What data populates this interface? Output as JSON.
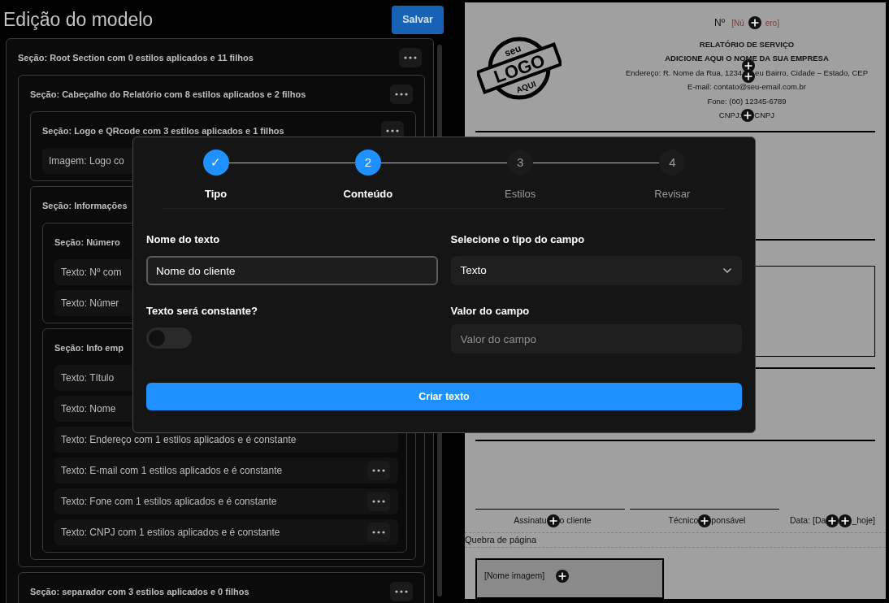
{
  "editor": {
    "title": "Edição do modelo",
    "save_button": "Salvar",
    "tree": [
      {
        "kind": "section",
        "label": "Seção: Root Section com 0 estilos aplicados e 11 filhos",
        "menu": true,
        "children": [
          {
            "kind": "section",
            "label": "Seção: Cabeçalho do Relatório com 8 estilos aplicados e 2 filhos",
            "menu": true,
            "children": [
              {
                "kind": "section",
                "label": "Seção: Logo e QRcode com 3 estilos aplicados e 1 filhos",
                "menu": true,
                "children": [
                  {
                    "kind": "item",
                    "label": "Imagem: Logo co"
                  }
                ]
              },
              {
                "kind": "section",
                "label": "Seção: Informações",
                "children": [
                  {
                    "kind": "section",
                    "label": "Seção: Número",
                    "children": [
                      {
                        "kind": "item",
                        "label": "Texto: Nº com"
                      },
                      {
                        "kind": "item",
                        "label": "Texto: Númer"
                      }
                    ]
                  },
                  {
                    "kind": "section",
                    "label": "Seção: Info emp",
                    "children": [
                      {
                        "kind": "item",
                        "label": "Texto: Título"
                      },
                      {
                        "kind": "item",
                        "label": "Texto: Nome"
                      },
                      {
                        "kind": "item",
                        "label": "Texto: Endereço com 1 estilos aplicados e é constante"
                      },
                      {
                        "kind": "item",
                        "label": "Texto: E-mail com 1 estilos aplicados e é constante",
                        "menu": true
                      },
                      {
                        "kind": "item",
                        "label": "Texto: Fone com 1 estilos aplicados e é constante",
                        "menu": true
                      },
                      {
                        "kind": "item",
                        "label": "Texto: CNPJ com 1 estilos aplicados e é constante",
                        "menu": true
                      }
                    ]
                  }
                ]
              }
            ]
          },
          {
            "kind": "section",
            "label": "Seção: separador com 3 estilos aplicados e 0 filhos",
            "menu": true
          }
        ]
      }
    ]
  },
  "document": {
    "logo": {
      "top": "seu",
      "middle": "LOGO",
      "bottom": "AQUI"
    },
    "header_lines": [
      {
        "kind": "number",
        "segments": [
          {
            "kind": "text",
            "text": "Nº"
          },
          {
            "kind": "placeholder",
            "text": "[Nú"
          },
          {
            "kind": "add"
          },
          {
            "kind": "placeholder",
            "text": "ero]"
          }
        ]
      },
      {
        "kind": "heading",
        "segments": [
          {
            "kind": "text",
            "text": "RELATÓRIO DE SERVIÇO"
          }
        ]
      },
      {
        "kind": "heading",
        "segments": [
          {
            "kind": "text",
            "text": "ADICIONE AQUI O NOME DA SUA EMPRESA"
          }
        ]
      },
      {
        "kind": "info",
        "segments": [
          {
            "kind": "text",
            "text": "Endereço: R. Nome da Rua, 1234"
          },
          {
            "kind": "add_stack"
          },
          {
            "kind": "text",
            "text": "eu Bairro, Cidade – Estado, CEP"
          }
        ]
      },
      {
        "kind": "info",
        "segments": [
          {
            "kind": "text",
            "text": "E-mail: contato@seu-email.com.br"
          }
        ]
      },
      {
        "kind": "info",
        "segments": [
          {
            "kind": "text",
            "text": "Fone: (00) 12345-6789"
          }
        ]
      },
      {
        "kind": "info",
        "segments": [
          {
            "kind": "text",
            "text": "CNPJ:"
          },
          {
            "kind": "add"
          },
          {
            "kind": "text",
            "text": "CNPJ"
          }
        ]
      }
    ],
    "signatures": [
      {
        "segments": [
          {
            "kind": "text",
            "text": "Assinatu"
          },
          {
            "kind": "add"
          },
          {
            "kind": "text",
            "text": "o cliente"
          }
        ]
      },
      {
        "segments": [
          {
            "kind": "text",
            "text": "Técnico"
          },
          {
            "kind": "add"
          },
          {
            "kind": "text",
            "text": "ponsável"
          }
        ]
      },
      {
        "segments": [
          {
            "kind": "text",
            "text": "Data: [Da"
          },
          {
            "kind": "add"
          },
          {
            "kind": "add"
          },
          {
            "kind": "text",
            "text": "_hoje]"
          }
        ]
      }
    ],
    "page_break": "Quebra de página",
    "image_block": {
      "segments": [
        {
          "kind": "text",
          "text": "[Nome imagem]"
        },
        {
          "kind": "add"
        }
      ]
    }
  },
  "modal": {
    "steps": [
      {
        "marker": "✓",
        "label": "Tipo",
        "active": true
      },
      {
        "marker": "2",
        "label": "Conteúdo",
        "active": true
      },
      {
        "marker": "3",
        "label": "Estilos",
        "active": false
      },
      {
        "marker": "4",
        "label": "Revisar",
        "active": false
      }
    ],
    "name_field": {
      "label": "Nome do texto",
      "value": "Nome do cliente"
    },
    "type_select": {
      "label": "Selecione o tipo do campo",
      "value": "Texto"
    },
    "constant_toggle": {
      "label": "Texto será constante?",
      "on": false
    },
    "value_field": {
      "label": "Valor do campo",
      "placeholder": "Valor do campo"
    },
    "submit_button": "Criar texto"
  }
}
